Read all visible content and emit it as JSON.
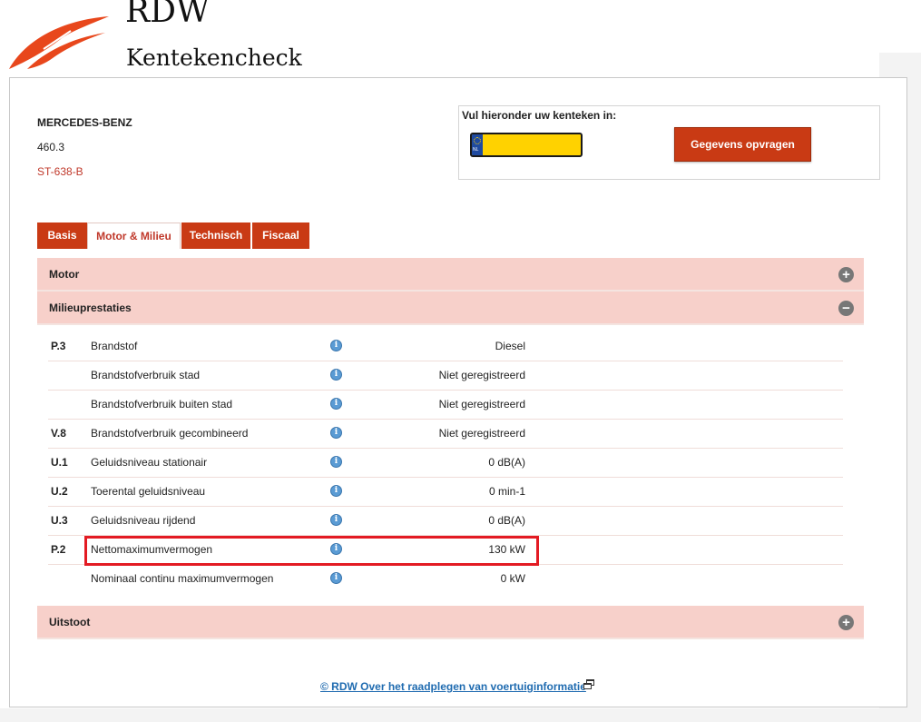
{
  "header": {
    "brand": "RDW",
    "subtitle": "Kentekencheck"
  },
  "vehicle": {
    "make": "MERCEDES-BENZ",
    "model": "460.3",
    "plate": "ST-638-B"
  },
  "plate_form": {
    "label": "Vul hieronder uw kenteken in:",
    "input_value": "",
    "input_placeholder": "",
    "country_code": "NL",
    "button_label": "Gegevens opvragen"
  },
  "tabs": [
    {
      "label": "Basis",
      "active": false
    },
    {
      "label": "Motor & Milieu",
      "active": true
    },
    {
      "label": "Technisch",
      "active": false
    },
    {
      "label": "Fiscaal",
      "active": false
    }
  ],
  "sections": {
    "motor": {
      "title": "Motor",
      "icon": "plus-icon",
      "expanded": false
    },
    "milieu": {
      "title": "Milieuprestaties",
      "icon": "minus-icon",
      "expanded": true
    },
    "uitstoot": {
      "title": "Uitstoot",
      "icon": "plus-icon",
      "expanded": false
    }
  },
  "rows": [
    {
      "code": "P.3",
      "label": "Brandstof",
      "value": "Diesel"
    },
    {
      "code": "",
      "label": "Brandstofverbruik stad",
      "value": "Niet geregistreerd"
    },
    {
      "code": "",
      "label": "Brandstofverbruik buiten stad",
      "value": "Niet geregistreerd"
    },
    {
      "code": "V.8",
      "label": "Brandstofverbruik gecombineerd",
      "value": "Niet geregistreerd"
    },
    {
      "code": "U.1",
      "label": "Geluidsniveau stationair",
      "value": "0 dB(A)"
    },
    {
      "code": "U.2",
      "label": "Toerental geluidsniveau",
      "value": "0 min-1"
    },
    {
      "code": "U.3",
      "label": "Geluidsniveau rijdend",
      "value": "0 dB(A)"
    },
    {
      "code": "P.2",
      "label": "Nettomaximumvermogen",
      "value": "130 kW",
      "highlighted": true
    },
    {
      "code": "",
      "label": "Nominaal continu maximumvermogen",
      "value": "0 kW"
    }
  ],
  "info_glyph": "i",
  "plus_glyph": "+",
  "minus_glyph": "−",
  "footer": {
    "link_text": "© RDW  Over het raadplegen van voertuiginformatie"
  },
  "colors": {
    "accent": "#c93a14",
    "plate_yellow": "#ffd200",
    "accordion_bg": "#f7d0ca",
    "highlight": "#e31b23",
    "link": "#1f6bb0"
  }
}
